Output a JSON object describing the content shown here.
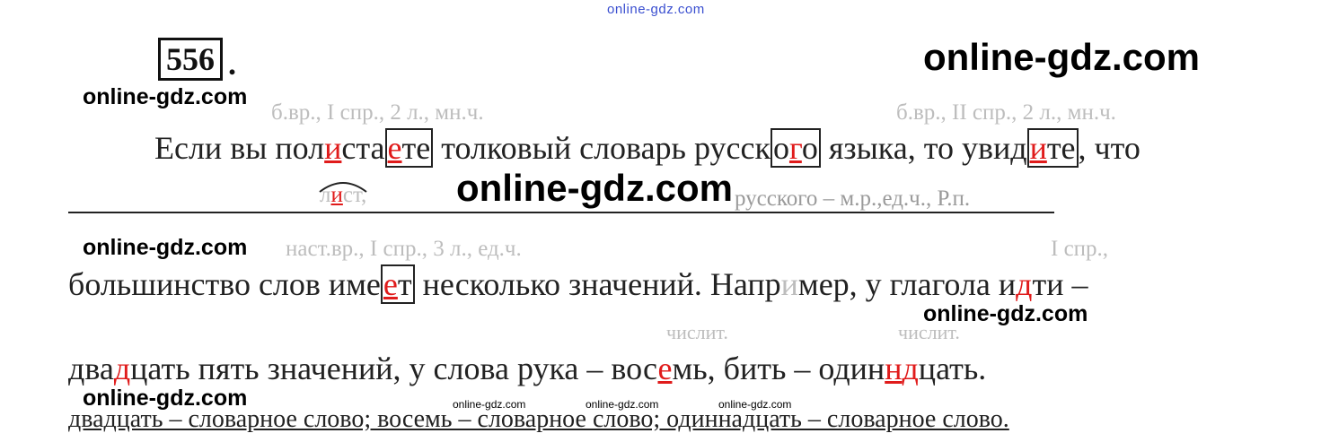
{
  "watermark": {
    "text": "online-gdz.com"
  },
  "exercise": {
    "number": "556",
    "dot": "."
  },
  "annotations": {
    "line1_left": "б.вр., I спр., 2 л., мн.ч.",
    "line1_right": "б.вр., II спр., 2 л., мн.ч.",
    "line2_left": "наст.вр., I спр., 3 л., ед.ч.",
    "line2_right": "I спр.,",
    "numeral1": "числит.",
    "numeral2": "числит."
  },
  "sentence1": {
    "p1": "Если вы пол",
    "r1": "и",
    "p2": "ста",
    "b1_r": "е",
    "b1_rest": "те",
    "p3": " толковый словарь русск",
    "b2_pre": "о",
    "b2_r": "г",
    "b2_post": "о",
    "p4": " языка, то увид",
    "b3_r": "и",
    "b3_rest": "те",
    "p5": ", что"
  },
  "analysis_line": {
    "morph_pre": "л",
    "morph_r": "и",
    "morph_post": "ст,",
    "case_note": "русского – м.р.,ед.ч., Р.п."
  },
  "sentence2": {
    "p1": "большинство слов име",
    "b1_r": "е",
    "b1_rest": "т",
    "p2": " несколько значений. Напр",
    "faint1": "и",
    "p3": "мер, у глагола и",
    "r1": "д",
    "p4": "ти –"
  },
  "sentence3": {
    "p1": "два",
    "r1": "д",
    "p2": "цать пять значений, у слова рука – вос",
    "r2": "е",
    "p3": "мь, бить – один",
    "r3": "н",
    "r4": "д",
    "p4": "цать."
  },
  "footer": {
    "text": "двадцать – словарное слово; восемь – словарное слово; одиннадцать – словарное слово."
  }
}
